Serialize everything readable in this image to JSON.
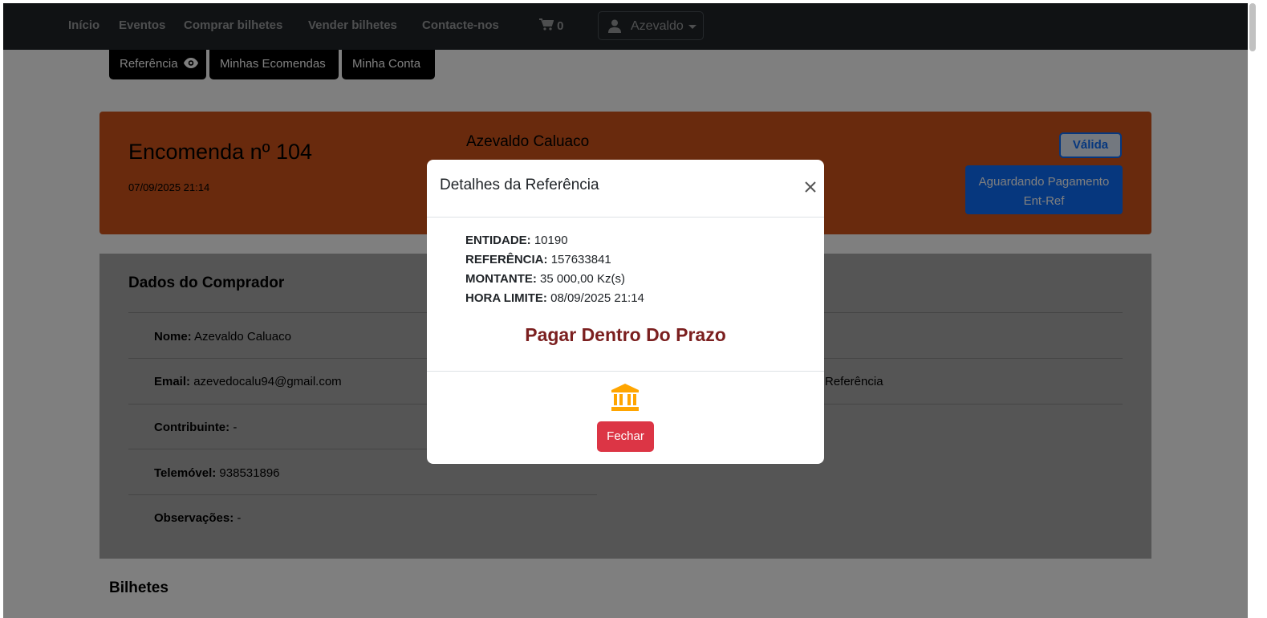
{
  "navbar": {
    "links": [
      "Início",
      "Eventos",
      "Comprar bilhetes",
      "Vender bilhetes",
      "Contacte-nos"
    ],
    "cart_count": "0",
    "user_name": "Azevaldo"
  },
  "subnav": {
    "reference_label": "Referência",
    "orders_label": "Minhas Ecomendas",
    "account_label": "Minha Conta"
  },
  "order": {
    "title": "Encomenda nº 104",
    "date": "07/09/2025 21:14",
    "customer_name": "Azevaldo Caluaco",
    "badge_valid": "Válida",
    "status_line1": "Aguardando Pagamento",
    "status_line2": "Ent-Ref"
  },
  "buyer": {
    "title": "Dados do Comprador",
    "name_label": "Nome:",
    "name_value": "Azevaldo Caluaco",
    "email_label": "Email:",
    "email_value": "azevedocalu94@gmail.com",
    "tax_label": "Contribuinte:",
    "tax_value": "-",
    "phone_label": "Telemóvel:",
    "phone_value": "938531896",
    "notes_label": "Observações:",
    "notes_value": "-",
    "right_text": "Referência"
  },
  "tickets_title": "Bilhetes",
  "modal": {
    "title": "Detalhes da Referência",
    "entity_label": "ENTIDADE:",
    "entity_value": "10190",
    "reference_label": "REFERÊNCIA:",
    "reference_value": "157633841",
    "amount_label": "MONTANTE:",
    "amount_value": "35 000,00 Kz(s)",
    "deadline_label": "HORA LIMITE:",
    "deadline_value": "08/09/2025 21:14",
    "message": "Pagar Dentro Do Prazo",
    "close_button": "Fechar"
  },
  "icons": {
    "cart": "cart-icon",
    "user": "user-icon",
    "eye": "eye-icon",
    "close": "close-icon",
    "bank": "bank-icon"
  },
  "colors": {
    "navbar": "#212529",
    "order_header": "#d2541b",
    "status_badge": "#0d6efd",
    "pay_message": "#7b1f1f",
    "bank_icon": "#ffa500",
    "close_button": "#dc3545"
  }
}
